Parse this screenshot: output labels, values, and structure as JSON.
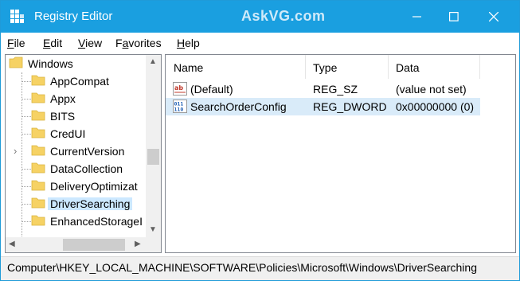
{
  "window": {
    "title": "Registry Editor",
    "watermark": "AskVG.com"
  },
  "menu": [
    {
      "underline": "F",
      "rest": "ile"
    },
    {
      "underline": "E",
      "rest": "dit"
    },
    {
      "underline": "V",
      "rest": "iew"
    },
    {
      "underline": "",
      "pre": "F",
      "mid": "a",
      "rest": "vorites"
    },
    {
      "underline": "H",
      "rest": "elp"
    }
  ],
  "tree": {
    "root": "Windows",
    "items": [
      "AppCompat",
      "Appx",
      "BITS",
      "CredUI",
      "CurrentVersion",
      "DataCollection",
      "DeliveryOptimizat",
      "DriverSearching",
      "EnhancedStorageI"
    ],
    "selected": "DriverSearching",
    "expandable": "CurrentVersion"
  },
  "values": {
    "columns": [
      "Name",
      "Type",
      "Data"
    ],
    "rows": [
      {
        "icon": "string-value-icon",
        "name": "(Default)",
        "type": "REG_SZ",
        "data": "(value not set)"
      },
      {
        "icon": "dword-value-icon",
        "name": "SearchOrderConfig",
        "type": "REG_DWORD",
        "data": "0x00000000 (0)"
      }
    ],
    "selected_row": 1
  },
  "status": {
    "path": "Computer\\HKEY_LOCAL_MACHINE\\SOFTWARE\\Policies\\Microsoft\\Windows\\DriverSearching"
  },
  "colors": {
    "titlebar": "#1a9fe0",
    "folder": "#f6d264",
    "selection": "#cce8ff"
  }
}
